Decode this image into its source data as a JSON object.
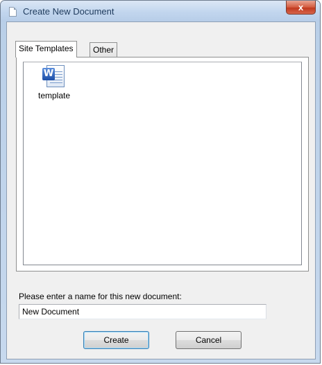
{
  "window": {
    "title": "Create New Document",
    "close_glyph": "x"
  },
  "tabs": [
    {
      "label": "Site Templates",
      "active": true
    },
    {
      "label": "Other",
      "active": false
    }
  ],
  "templates": [
    {
      "label": "template",
      "icon": "word-document-icon",
      "badge": "W"
    }
  ],
  "form": {
    "prompt": "Please enter a name for this new document:",
    "name_value": "New Document"
  },
  "buttons": {
    "create_label": "Create",
    "cancel_label": "Cancel"
  },
  "colors": {
    "frame": "#b9cfe8",
    "close_button": "#c0391f",
    "dialog_bg": "#f0f0f0"
  }
}
